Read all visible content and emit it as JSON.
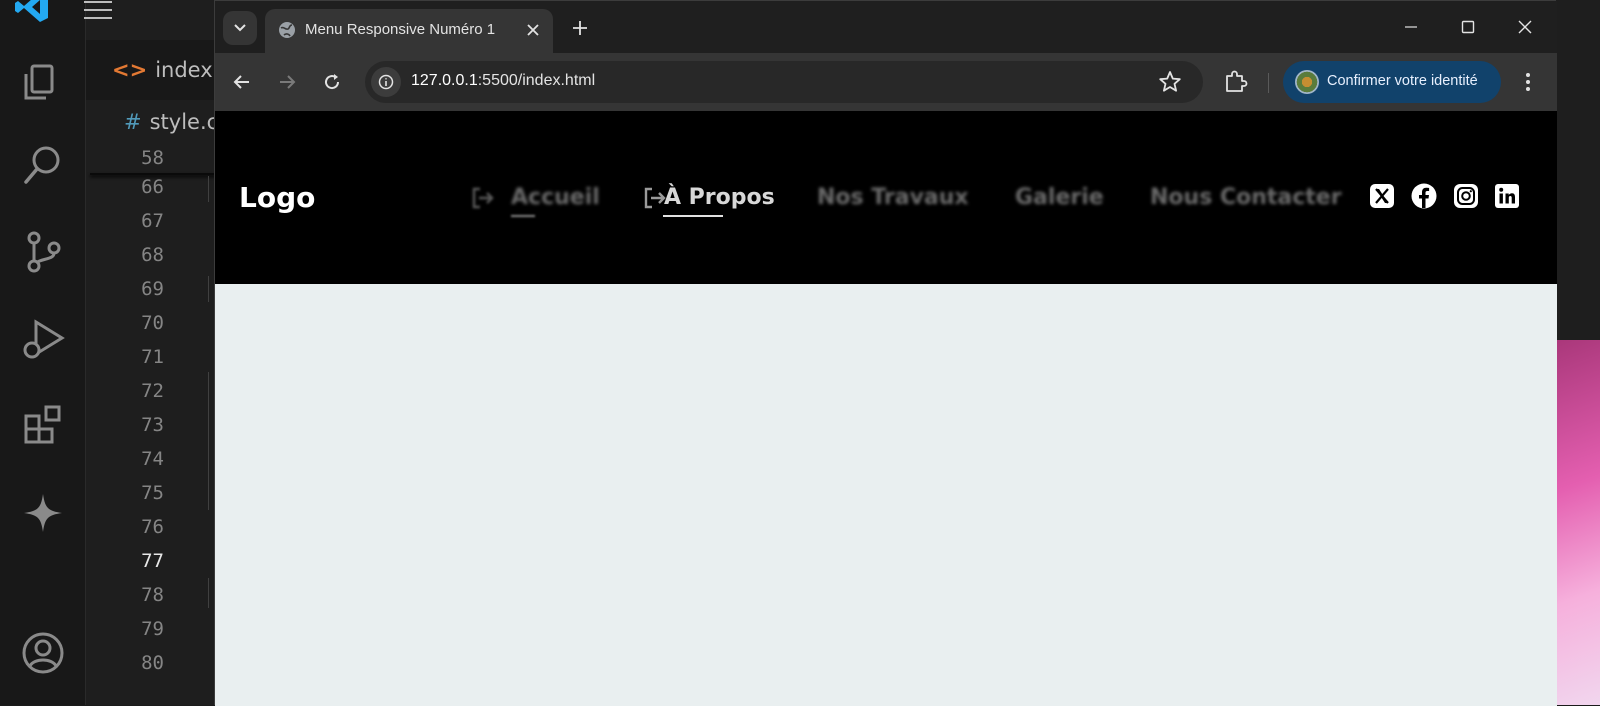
{
  "vscode": {
    "editor_tab": "index.h",
    "breadcrumb": "style.c",
    "line_numbers": [
      "58",
      "66",
      "67",
      "68",
      "69",
      "70",
      "71",
      "72",
      "73",
      "74",
      "75",
      "76",
      "77",
      "78",
      "79",
      "80"
    ],
    "active_line": "77",
    "icons": [
      "vscode-logo-icon",
      "hamburger-menu-icon",
      "explorer-icon",
      "search-icon",
      "source-control-icon",
      "run-debug-icon",
      "extensions-icon",
      "copilot-sparkle-icon",
      "account-icon"
    ]
  },
  "chrome": {
    "tab_title": "Menu Responsive Numéro 1",
    "url_host": "127.0.0.1",
    "url_rest": ":5500/index.html",
    "profile_label": "Confirmer votre identité"
  },
  "site": {
    "logo": "Logo",
    "nav": [
      {
        "label": "Accueil",
        "active": false
      },
      {
        "label": "À Propos",
        "active": true
      },
      {
        "label": "Nos Travaux",
        "active": false
      },
      {
        "label": "Galerie",
        "active": false
      },
      {
        "label": "Nous Contacter",
        "active": false
      }
    ],
    "social_icons": [
      "x-twitter-icon",
      "facebook-icon",
      "instagram-icon",
      "linkedin-icon"
    ]
  },
  "colors": {
    "header_bg": "#000000",
    "page_bg": "#e9eff0",
    "profile_chip": "#11426b",
    "vscode_bg": "#1e1e1e"
  }
}
